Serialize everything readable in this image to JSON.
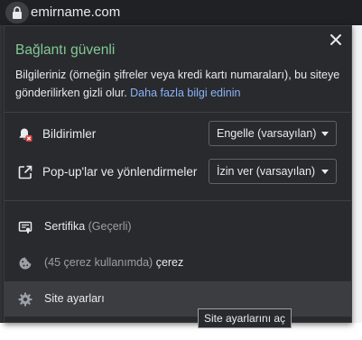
{
  "omnibox": {
    "url": "emirname.com",
    "lock_icon": "lock-icon"
  },
  "popup": {
    "title": "Bağlantı güvenli",
    "description": "Bilgileriniz (örneğin şifreler veya kredi kartı numaraları), bu siteye gönderilirken gizli olur. ",
    "learn_more": "Daha fazla bilgi edinin",
    "close_icon": "close-icon",
    "title_color": "#81c995",
    "link_color": "#8ab4f8"
  },
  "permissions": [
    {
      "label": "Bildirimler",
      "icon": "notifications-blocked-icon",
      "value": "Engelle (varsayılan)"
    },
    {
      "label": "Pop-up'lar ve yönlendirmeler",
      "icon": "popup-redirect-icon",
      "value": "İzin ver (varsayılan)"
    }
  ],
  "certificate": {
    "label": "Sertifika",
    "status": "(Geçerli)",
    "icon": "certificate-icon"
  },
  "cookies": {
    "count_text": "(45 çerez kullanımda)",
    "label": "çerez",
    "icon": "cookie-icon"
  },
  "site_settings": {
    "label": "Site ayarları",
    "icon": "gear-icon",
    "tooltip": "Site ayarlarını aç"
  }
}
